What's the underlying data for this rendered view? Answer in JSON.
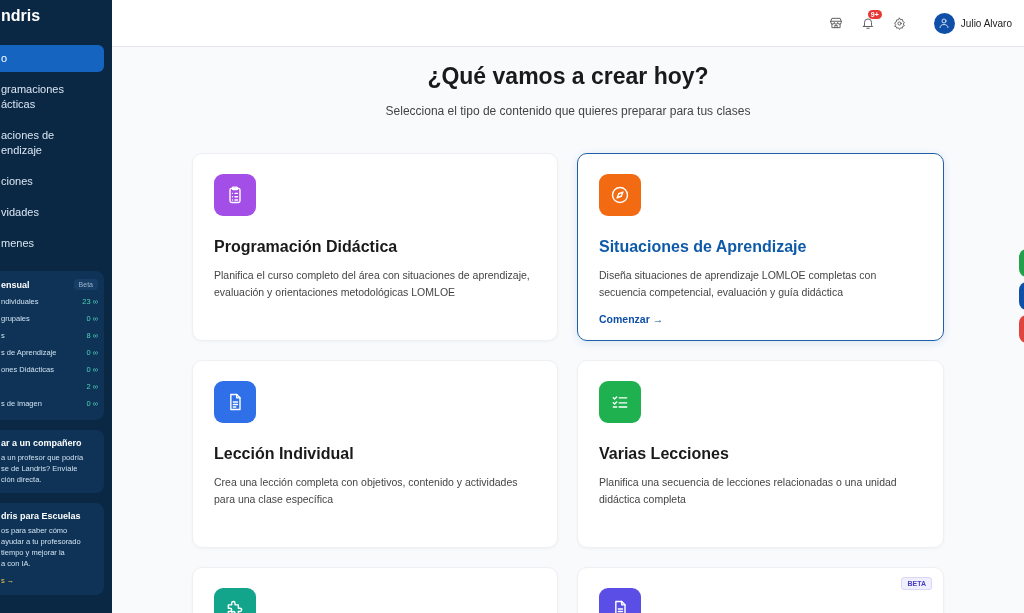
{
  "sidebar": {
    "logo": "ndris",
    "nav": [
      {
        "lines": [
          "o"
        ],
        "selected": true
      },
      {
        "lines": [
          "gramaciones",
          "ácticas"
        ],
        "selected": false
      },
      {
        "lines": [
          "aciones de",
          "endizaje"
        ],
        "selected": false
      },
      {
        "lines": [
          "ciones"
        ],
        "selected": false
      },
      {
        "lines": [
          "vidades"
        ],
        "selected": false
      },
      {
        "lines": [
          "menes"
        ],
        "selected": false
      }
    ],
    "usage": {
      "title": "ensual",
      "badge": "Beta",
      "rows": [
        {
          "label": "ndividuales",
          "value": "23 ∞"
        },
        {
          "label": "grupales",
          "value": "0 ∞"
        },
        {
          "label": "s",
          "value": "8 ∞"
        },
        {
          "label": "s de Aprendizaje",
          "value": "0 ∞"
        },
        {
          "label": "ones Didácticas",
          "value": "0 ∞"
        },
        {
          "value": "2 ∞"
        },
        {
          "label": "s de imagen",
          "value": "0 ∞"
        }
      ]
    },
    "promos": [
      {
        "title": "ar a un compañero",
        "lines": [
          "a un profesor que podría",
          "se de Landris? Envíale",
          "ción directa."
        ]
      },
      {
        "title": "dris para Escuelas",
        "lines": [
          "os para saber cómo",
          "ayudar a tu profesorado",
          "tiempo y mejorar la",
          "a con IA."
        ],
        "link": "s →"
      }
    ]
  },
  "topbar": {
    "notifications": "9+",
    "user": "Julio Alvaro"
  },
  "heading": "¿Qué vamos a crear hoy?",
  "subheading": "Selecciona el tipo de contenido que quieres preparar para tus clases",
  "cards": [
    {
      "kind": "clipboard",
      "color": "#a44ee8",
      "title": "Programación Didáctica",
      "description": "Planifica el curso completo del área con situaciones de aprendizaje, evaluación y orientaciones metodológicas LOMLOE",
      "selected": false
    },
    {
      "kind": "compass",
      "color": "#f26a12",
      "title": "Situaciones de Aprendizaje",
      "description": "Diseña situaciones de aprendizaje LOMLOE completas con secuencia competencial, evaluación y guía didáctica",
      "selected": true,
      "action": "Comenzar →"
    },
    {
      "kind": "document",
      "color": "#2f6fe8",
      "title": "Lección Individual",
      "description": "Crea una lección completa con objetivos, contenido y actividades para una clase específica",
      "selected": false
    },
    {
      "kind": "checklist",
      "color": "#1fb14f",
      "title": "Varias Lecciones",
      "description": "Planifica una secuencia de lecciones relacionadas o una unidad didáctica completa",
      "selected": false
    },
    {
      "kind": "puzzle",
      "color": "#13a58c",
      "selected": false
    },
    {
      "kind": "document",
      "color": "#5a4ee6",
      "badge": "BETA",
      "selected": false
    }
  ],
  "side_tabs": [
    {
      "color": "#22a04b"
    },
    {
      "color": "#0f4fa8"
    },
    {
      "color": "#e0443e"
    }
  ]
}
